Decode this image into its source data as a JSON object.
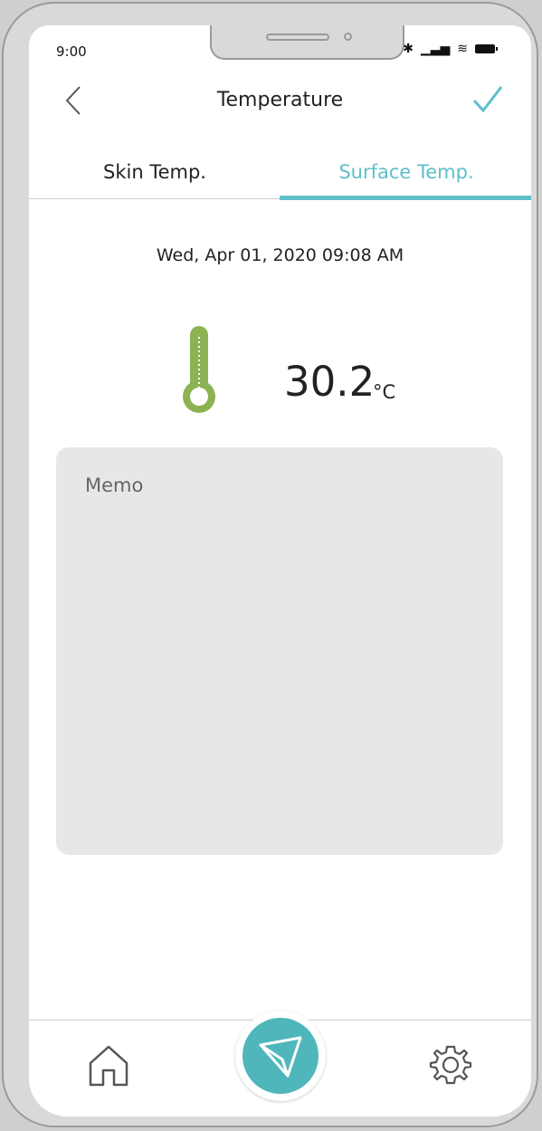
{
  "status": {
    "time": "9:00",
    "bluetooth": "bluetooth-icon",
    "signal": "signal-icon",
    "wifi": "wifi-icon",
    "battery": "battery-icon"
  },
  "header": {
    "title": "Temperature",
    "back_icon": "back-chevron-icon",
    "confirm_icon": "check-icon"
  },
  "tabs": [
    {
      "label": "Skin Temp.",
      "active": false
    },
    {
      "label": "Surface Temp.",
      "active": true
    }
  ],
  "reading": {
    "datetime": "Wed, Apr 01, 2020 09:08 AM",
    "value": "30.2",
    "unit": "°C"
  },
  "memo": {
    "placeholder": "Memo"
  },
  "bottom_nav": {
    "home_icon": "home-icon",
    "center_icon": "send-plane-icon",
    "settings_icon": "gear-icon"
  },
  "colors": {
    "accent": "#5ec0c8",
    "fab": "#4fb7bb",
    "thermometer": "#8db253",
    "memo_bg": "#e7e7e7"
  }
}
